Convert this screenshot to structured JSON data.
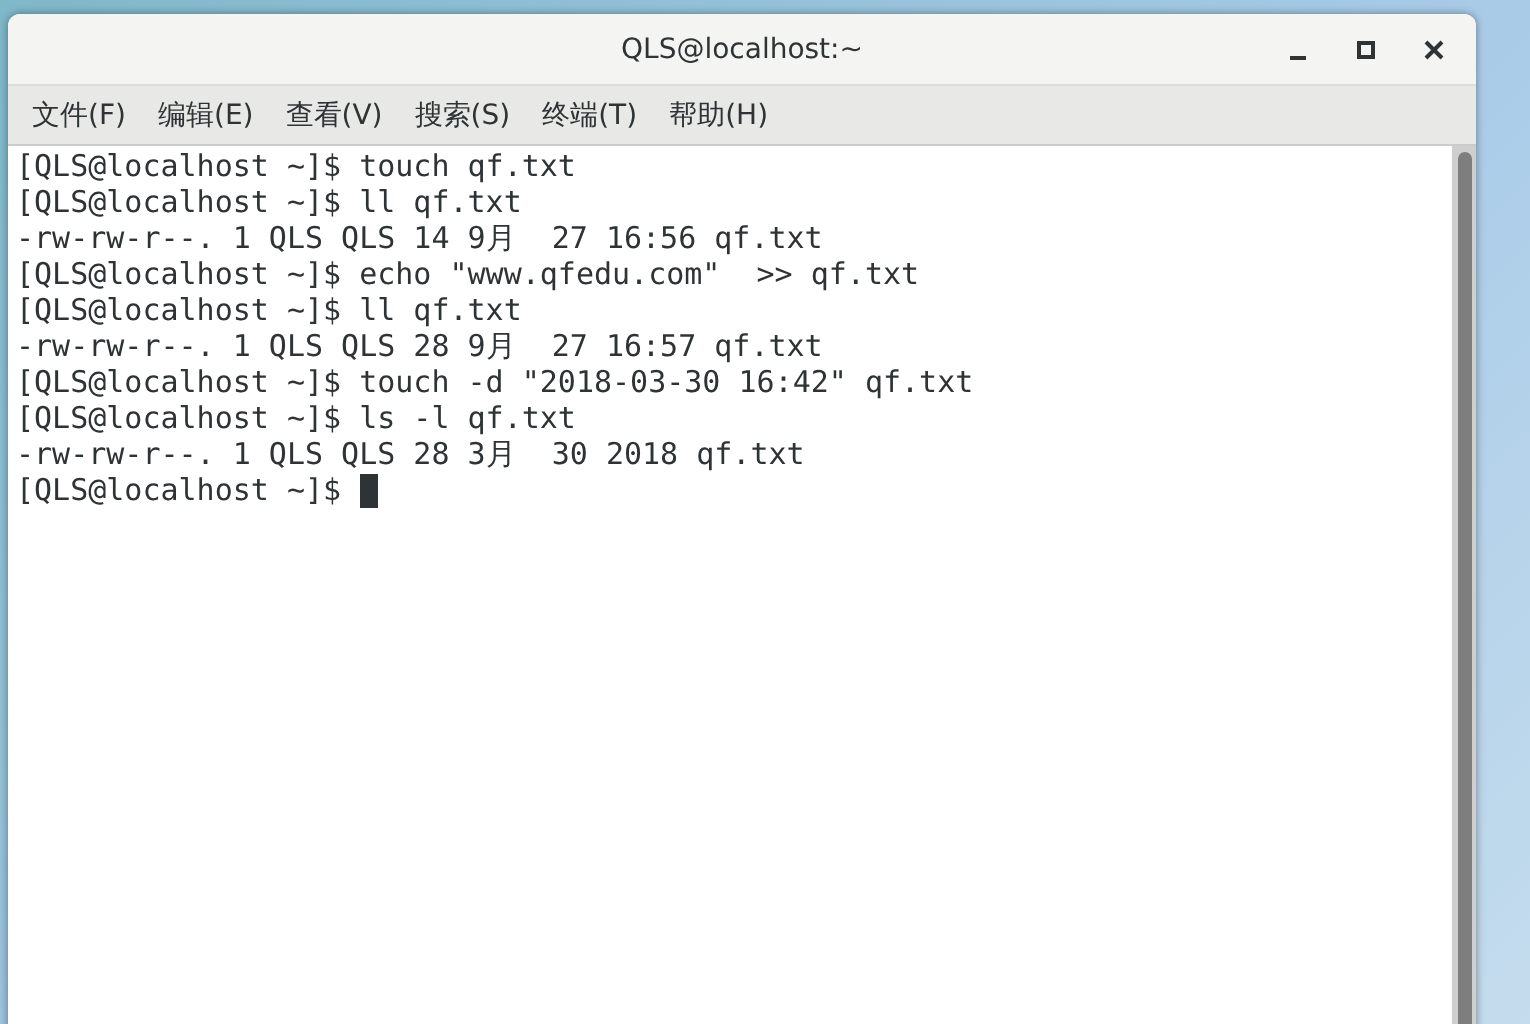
{
  "window": {
    "title": "QLS@localhost:~"
  },
  "menu": [
    "文件(F)",
    "编辑(E)",
    "查看(V)",
    "搜索(S)",
    "终端(T)",
    "帮助(H)"
  ],
  "terminal": {
    "lines": [
      "[QLS@localhost ~]$ touch qf.txt",
      "[QLS@localhost ~]$ ll qf.txt",
      "-rw-rw-r--. 1 QLS QLS 14 9月  27 16:56 qf.txt",
      "[QLS@localhost ~]$ echo \"www.qfedu.com\"  >> qf.txt",
      "[QLS@localhost ~]$ ll qf.txt",
      "-rw-rw-r--. 1 QLS QLS 28 9月  27 16:57 qf.txt",
      "[QLS@localhost ~]$ touch -d \"2018-03-30 16:42\" qf.txt",
      "[QLS@localhost ~]$ ls -l qf.txt",
      "-rw-rw-r--. 1 QLS QLS 28 3月  30 2018 qf.txt"
    ],
    "prompt": "[QLS@localhost ~]$ "
  }
}
